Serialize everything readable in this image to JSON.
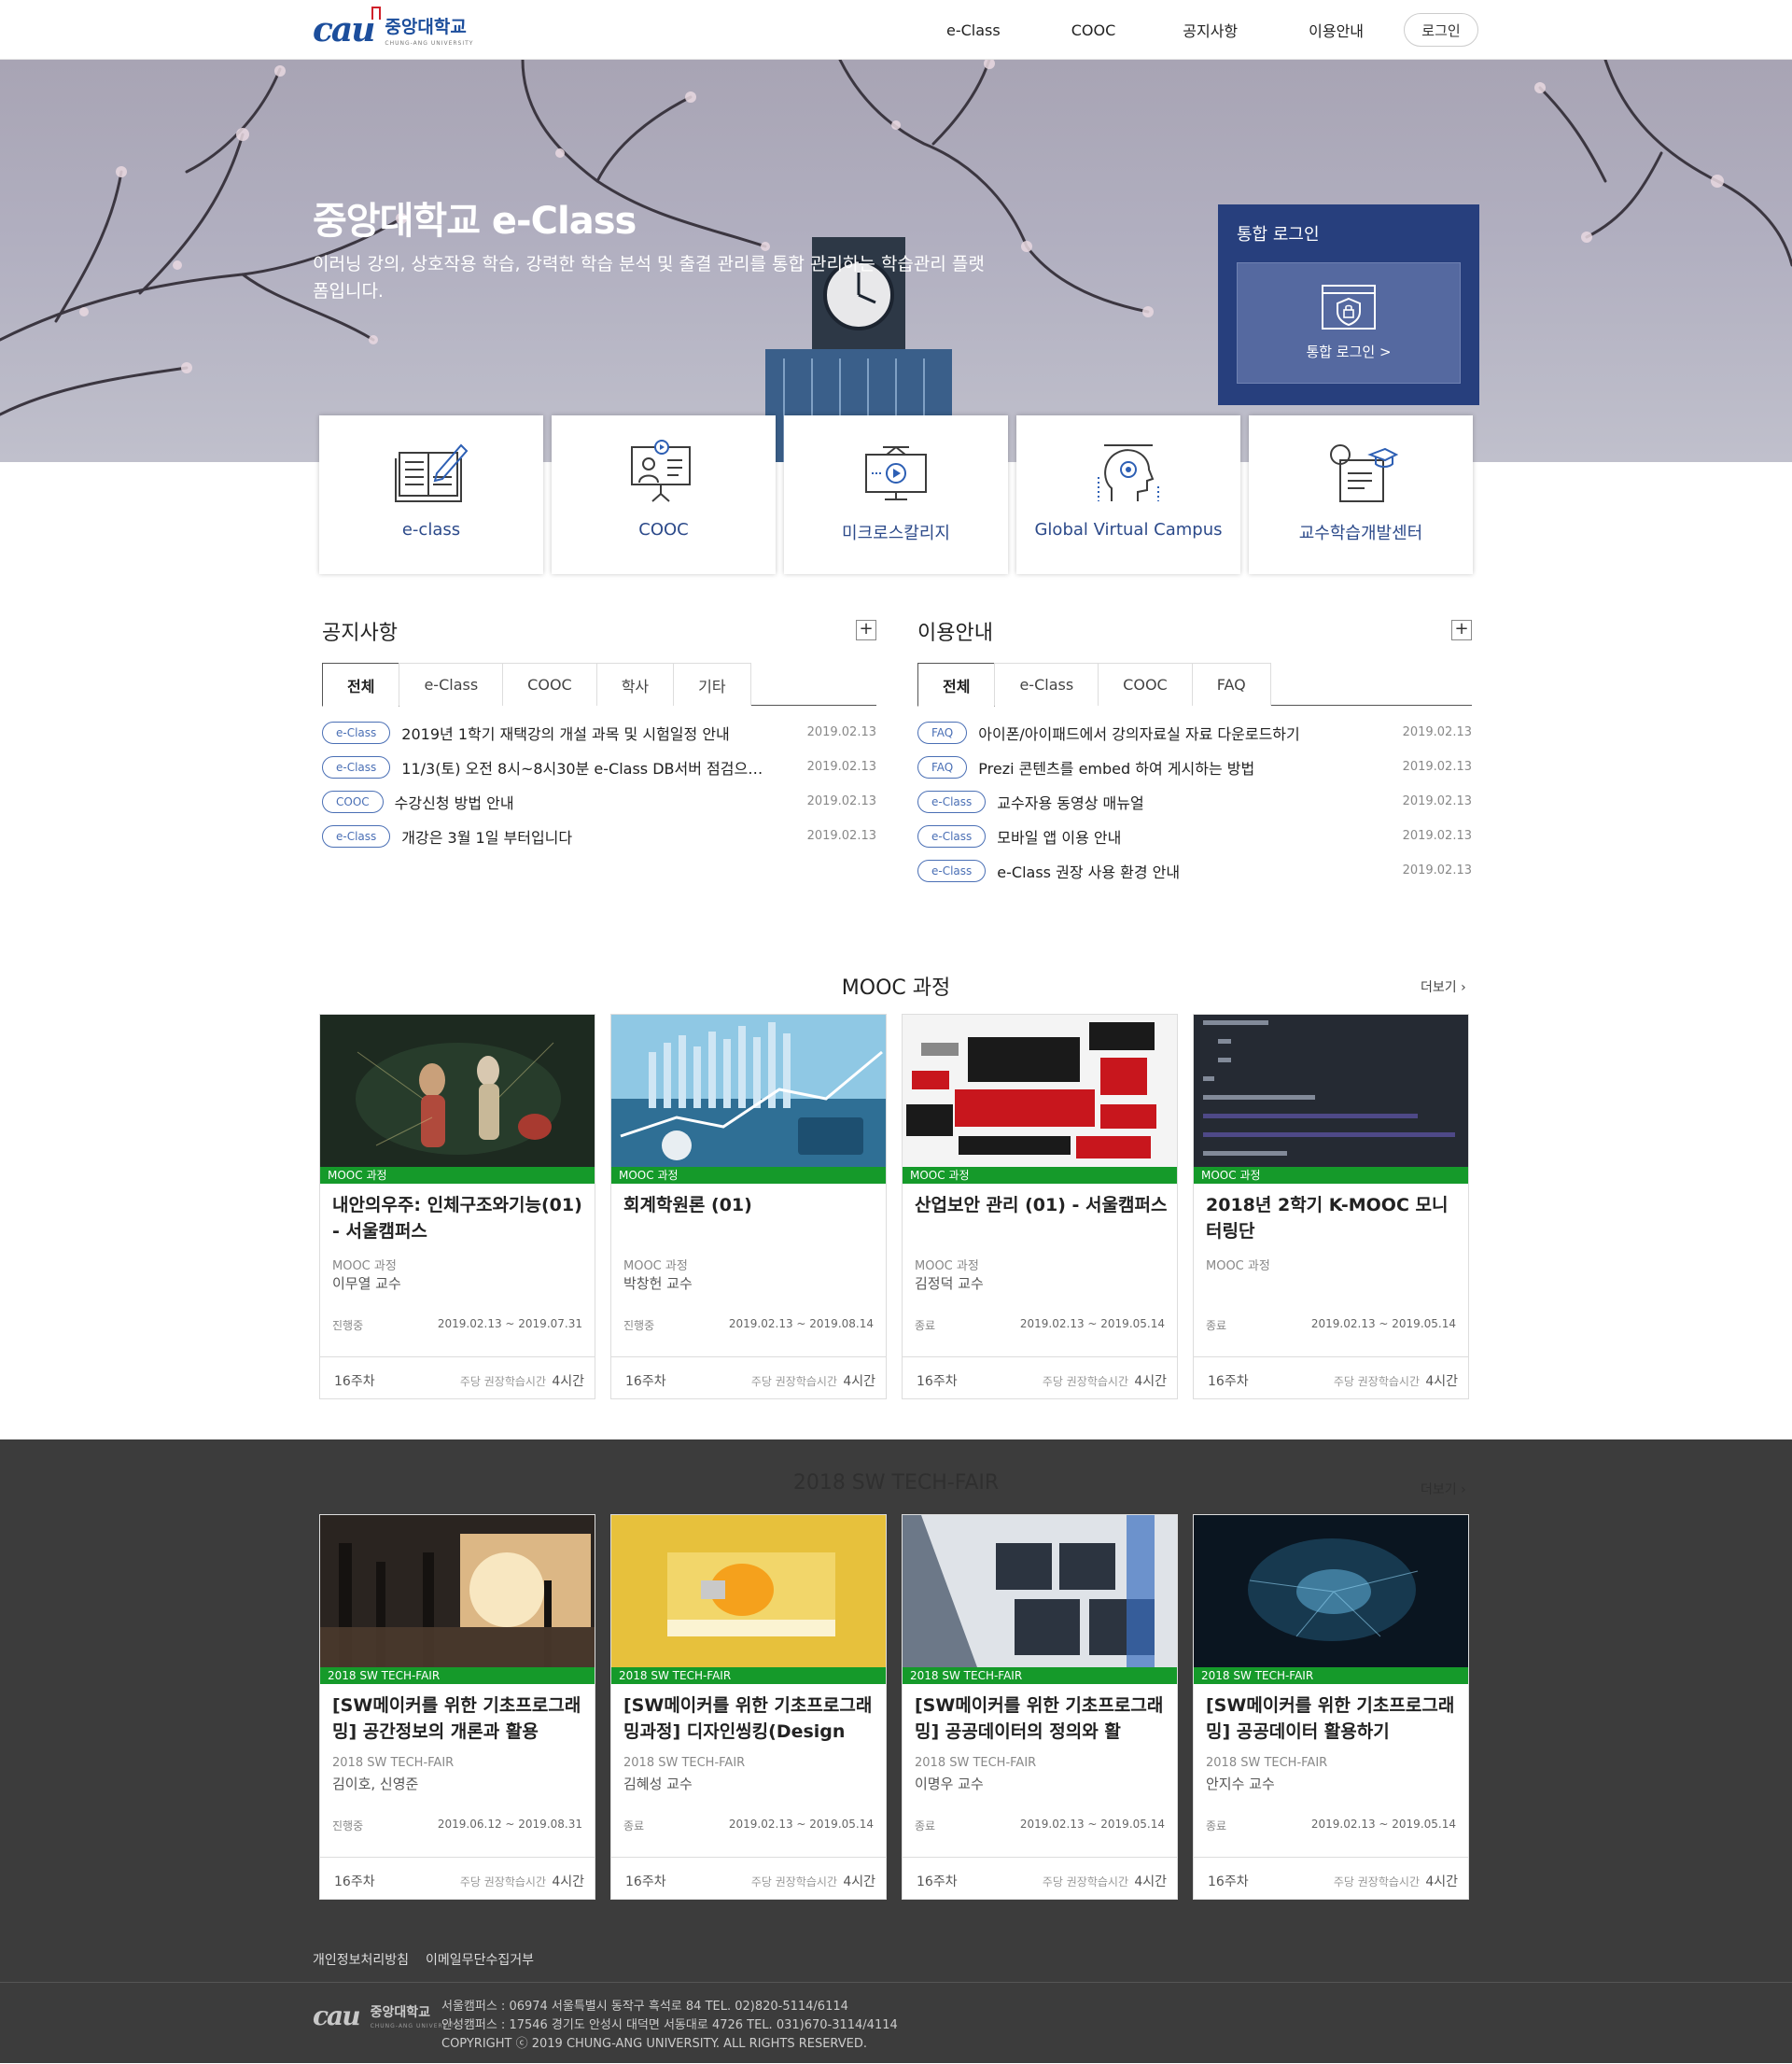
{
  "header": {
    "logo_kr": "중앙대학교",
    "logo_en": "CHUNG-ANG UNIVERSITY",
    "nav": [
      "e-Class",
      "COOC",
      "공지사항",
      "이용안내"
    ],
    "login": "로그인"
  },
  "hero": {
    "title": "중앙대학교 e-Class",
    "desc": "이러닝 강의, 상호작용 학습, 강력한 학습 분석 및 출결 관리를 통합 관리하는 학습관리 플랫폼입니다.",
    "login_box_title": "통합 로그인",
    "login_box_button": "통합 로그인 >"
  },
  "quick": [
    {
      "label": "e-class",
      "icon": "book-pen-icon"
    },
    {
      "label": "COOC",
      "icon": "presenter-icon"
    },
    {
      "label": "미크로스칼리지",
      "icon": "monitor-play-icon"
    },
    {
      "label": "Global Virtual Campus",
      "icon": "head-gear-icon"
    },
    {
      "label": "교수학습개발센터",
      "icon": "certificate-icon"
    }
  ],
  "notice": {
    "title": "공지사항",
    "tabs": [
      "전체",
      "e-Class",
      "COOC",
      "학사",
      "기타"
    ],
    "rows": [
      {
        "badge": "e-Class",
        "title": "2019년 1학기 재택강의 개설 과목 및 시험일정 안내",
        "date": "2019.02.13"
      },
      {
        "badge": "e-Class",
        "title": "11/3(토) 오전 8시~8시30분 e-Class DB서버 점검으로 ...",
        "date": "2019.02.13"
      },
      {
        "badge": "COOC",
        "title": "수강신청 방법 안내",
        "date": "2019.02.13"
      },
      {
        "badge": "e-Class",
        "title": "개강은 3월 1일 부터입니다",
        "date": "2019.02.13"
      }
    ]
  },
  "guide": {
    "title": "이용안내",
    "tabs": [
      "전체",
      "e-Class",
      "COOC",
      "FAQ"
    ],
    "rows": [
      {
        "badge": "FAQ",
        "title": "아이폰/아이패드에서 강의자료실 자료 다운로드하기",
        "date": "2019.02.13"
      },
      {
        "badge": "FAQ",
        "title": "Prezi 콘텐츠를 embed 하여 게시하는 방법",
        "date": "2019.02.13"
      },
      {
        "badge": "e-Class",
        "title": "교수자용 동영상 매뉴얼",
        "date": "2019.02.13"
      },
      {
        "badge": "e-Class",
        "title": "모바일 앱 이용 안내",
        "date": "2019.02.13"
      },
      {
        "badge": "e-Class",
        "title": "e-Class 권장 사용 환경 안내",
        "date": "2019.02.13"
      }
    ]
  },
  "mooc": {
    "title": "MOOC 과정",
    "more": "더보기",
    "cards": [
      {
        "bar": "MOOC 과정",
        "title": "내안의우주: 인체구조와기능(01) - 서울캠퍼스",
        "cat": "MOOC 과정",
        "prof": "이무열 교수",
        "status": "진행중",
        "period": "2019.02.13 ~ 2019.07.31",
        "week": "16주차",
        "hours_label": "주당 권장학습시간",
        "hours": "4시간"
      },
      {
        "bar": "MOOC 과정",
        "title": "회계학원론 (01)",
        "cat": "MOOC 과정",
        "prof": "박창헌 교수",
        "status": "진행중",
        "period": "2019.02.13 ~ 2019.08.14",
        "week": "16주차",
        "hours_label": "주당 권장학습시간",
        "hours": "4시간"
      },
      {
        "bar": "MOOC 과정",
        "title": "산업보안 관리 (01) - 서울캠퍼스",
        "cat": "MOOC 과정",
        "prof": "김정덕 교수",
        "status": "종료",
        "period": "2019.02.13 ~ 2019.05.14",
        "week": "16주차",
        "hours_label": "주당 권장학습시간",
        "hours": "4시간"
      },
      {
        "bar": "MOOC 과정",
        "title": "2018년 2학기 K-MOOC 모니터링단",
        "cat": "MOOC 과정",
        "prof": "",
        "status": "종료",
        "period": "2019.02.13 ~ 2019.05.14",
        "week": "16주차",
        "hours_label": "주당 권장학습시간",
        "hours": "4시간"
      }
    ]
  },
  "tech": {
    "title": "2018 SW TECH-FAIR",
    "more": "더보기",
    "cards": [
      {
        "bar": "2018 SW TECH-FAIR",
        "title": "[SW메이커를 위한 기초프로그래밍] 공간정보의 개론과 활용",
        "cat": "2018 SW TECH-FAIR",
        "prof": "김이호, 신영준",
        "status": "진행중",
        "period": "2019.06.12 ~ 2019.08.31",
        "week": "16주차",
        "hours_label": "주당 권장학습시간",
        "hours": "4시간"
      },
      {
        "bar": "2018 SW TECH-FAIR",
        "title": "[SW메이커를 위한 기초프로그래밍과정] 디자인씽킹(Design",
        "cat": "2018 SW TECH-FAIR",
        "prof": "김혜성 교수",
        "status": "종료",
        "period": "2019.02.13 ~ 2019.05.14",
        "week": "16주차",
        "hours_label": "주당 권장학습시간",
        "hours": "4시간"
      },
      {
        "bar": "2018 SW TECH-FAIR",
        "title": "[SW메이커를 위한 기초프로그래밍] 공공데이터의 정의와 활",
        "cat": "2018 SW TECH-FAIR",
        "prof": "이명우 교수",
        "status": "종료",
        "period": "2019.02.13 ~ 2019.05.14",
        "week": "16주차",
        "hours_label": "주당 권장학습시간",
        "hours": "4시간"
      },
      {
        "bar": "2018 SW TECH-FAIR",
        "title": "[SW메이커를 위한 기초프로그래밍] 공공데이터 활용하기",
        "cat": "2018 SW TECH-FAIR",
        "prof": "안지수 교수",
        "status": "종료",
        "period": "2019.02.13 ~ 2019.05.14",
        "week": "16주차",
        "hours_label": "주당 권장학습시간",
        "hours": "4시간"
      }
    ]
  },
  "footer": {
    "links": [
      "개인정보처리방침",
      "이메일무단수집거부"
    ],
    "logo_kr": "중앙대학교",
    "logo_en": "CHUNG-ANG UNIVERSITY",
    "info": [
      "서울캠퍼스 : 06974 서울특별시 동작구 흑석로 84 TEL. 02)820-5114/6114",
      "안성캠퍼스 : 17546 경기도 안성시 대덕면 서동대로 4726 TEL. 031)670-3114/4114",
      "COPYRIGHT ⓒ 2019 CHUNG-ANG UNIVERSITY. ALL RIGHTS RESERVED."
    ]
  },
  "colors": {
    "brand": "#1c4e9c",
    "login_box": "#273f7d",
    "card_bar": "#159a2a",
    "dark_band": "#3c3c3c"
  }
}
